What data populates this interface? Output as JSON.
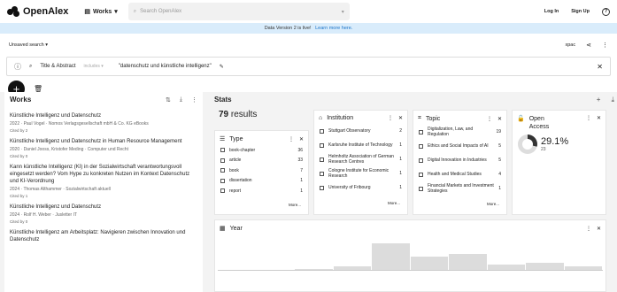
{
  "app": {
    "brand": "OpenAlex"
  },
  "nav": {
    "entity": "Works",
    "search_placeholder": "Search OpenAlex",
    "login": "Log In",
    "signup": "Sign Up"
  },
  "banner": {
    "text": "Data Version 2 is live!",
    "link": "Learn more here."
  },
  "toolbar": {
    "saved": "Unsaved search",
    "user": "xpac"
  },
  "filter": {
    "field": "Title & Abstract",
    "operator": "includes",
    "value": "\"datenschutz und künstliche intelligenz\""
  },
  "works": {
    "title": "Works",
    "items": [
      {
        "title": "Künstliche Intelligenz und Datenschutz",
        "meta": "2022 · Paul Vogel · Nomos Verlagsgesellschaft mbH & Co. KG eBooks",
        "cited": "Cited by 2"
      },
      {
        "title": "Künstliche Intelligenz und Datenschutz in Human Resource Management",
        "meta": "2020 · Daniel Jooss, Kristofer Meding · Computer und Recht",
        "cited": "Cited by 0"
      },
      {
        "title": "Kann künstliche Intelligenz (KI) in der Sozialwirtschaft verantwortungsvoll eingesetzt werden? Vom Hype zu konkreten Nutzen im Kontext Datenschutz und KI-Verordnung",
        "meta": "2024 · Thomas Althammer · Sozialwirtschaft aktuell",
        "cited": "Cited by 1"
      },
      {
        "title": "Künstliche Intelligenz und Datenschutz",
        "meta": "2024 · Rolf H. Weber · Jusletter IT",
        "cited": "Cited by 0"
      },
      {
        "title": "Künstliche Intelligenz am Arbeitsplatz: Navigieren zwischen Innovation und Datenschutz",
        "meta": "",
        "cited": ""
      }
    ]
  },
  "stats": {
    "title": "Stats",
    "results_count": "79",
    "results_label": "results",
    "type": {
      "title": "Type",
      "rows": [
        {
          "label": "book-chapter",
          "count": "36"
        },
        {
          "label": "article",
          "count": "33"
        },
        {
          "label": "book",
          "count": "7"
        },
        {
          "label": "dissertation",
          "count": "1"
        },
        {
          "label": "report",
          "count": "1"
        }
      ],
      "more": "More..."
    },
    "institution": {
      "title": "Institution",
      "rows": [
        {
          "label": "Stuttgart Observatory",
          "count": "2"
        },
        {
          "label": "Karlsruhe Institute of Technology",
          "count": "1"
        },
        {
          "label": "Helmholtz Association of German Research Centres",
          "count": "1"
        },
        {
          "label": "Cologne Institute for Economic Research",
          "count": "1"
        },
        {
          "label": "University of Fribourg",
          "count": "1"
        }
      ],
      "more": "More..."
    },
    "topic": {
      "title": "Topic",
      "rows": [
        {
          "label": "Digitalization, Law, and Regulation",
          "count": "19"
        },
        {
          "label": "Ethics and Social Impacts of AI",
          "count": "5"
        },
        {
          "label": "Digital Innovation in Industries",
          "count": "5"
        },
        {
          "label": "Health and Medical Studies",
          "count": "4"
        },
        {
          "label": "Financial Markets and Investment Strategies",
          "count": "1"
        }
      ],
      "more": "More..."
    },
    "open_access": {
      "title": "Open Access",
      "percent": "29.1%",
      "count": "23",
      "fraction": 0.291
    },
    "year": {
      "title": "Year",
      "bars": [
        0,
        0,
        0.02,
        0.1,
        0.78,
        0.38,
        0.45,
        0.15,
        0.2,
        0.1
      ]
    }
  },
  "colors": {
    "banner": "#d9ecfb",
    "link": "#1a73c8",
    "bar": "#dcdcdc"
  }
}
